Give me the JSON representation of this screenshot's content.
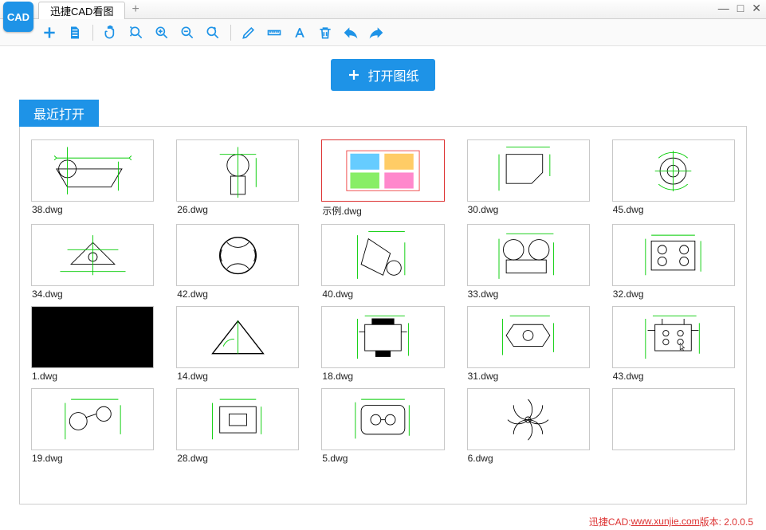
{
  "titlebar": {
    "app_icon_text": "CAD",
    "tab_title": "迅捷CAD看图"
  },
  "toolbar": {
    "icons": [
      {
        "name": "plus-icon"
      },
      {
        "name": "file-icon"
      },
      {
        "name": "pan-icon"
      },
      {
        "name": "zoom-fit-icon"
      },
      {
        "name": "zoom-in-icon"
      },
      {
        "name": "zoom-out-icon"
      },
      {
        "name": "rotate-icon"
      },
      {
        "name": "edit-icon"
      },
      {
        "name": "ruler-icon"
      },
      {
        "name": "text-icon"
      },
      {
        "name": "delete-icon"
      },
      {
        "name": "undo-icon"
      },
      {
        "name": "redo-icon"
      }
    ]
  },
  "content": {
    "open_button_label": "打开图纸",
    "recent_label": "最近打开",
    "files": [
      {
        "name": "38.dwg",
        "kind": "cad-a"
      },
      {
        "name": "26.dwg",
        "kind": "cad-b"
      },
      {
        "name": "示例.dwg",
        "kind": "example",
        "redborder": true
      },
      {
        "name": "30.dwg",
        "kind": "cad-c"
      },
      {
        "name": "45.dwg",
        "kind": "cad-d"
      },
      {
        "name": "34.dwg",
        "kind": "cad-e"
      },
      {
        "name": "42.dwg",
        "kind": "cad-f"
      },
      {
        "name": "40.dwg",
        "kind": "cad-g"
      },
      {
        "name": "33.dwg",
        "kind": "cad-h"
      },
      {
        "name": "32.dwg",
        "kind": "cad-i"
      },
      {
        "name": "1.dwg",
        "kind": "black"
      },
      {
        "name": "14.dwg",
        "kind": "cad-j"
      },
      {
        "name": "18.dwg",
        "kind": "cad-k"
      },
      {
        "name": "31.dwg",
        "kind": "cad-l"
      },
      {
        "name": "43.dwg",
        "kind": "cad-m",
        "cursor": true
      },
      {
        "name": "19.dwg",
        "kind": "cad-n"
      },
      {
        "name": "28.dwg",
        "kind": "cad-o"
      },
      {
        "name": "5.dwg",
        "kind": "cad-p"
      },
      {
        "name": "6.dwg",
        "kind": "cad-q"
      },
      {
        "name": "",
        "kind": "empty"
      }
    ]
  },
  "footer": {
    "prefix": "迅捷CAD: ",
    "url": "www.xunjie.com",
    "suffix": " 版本: 2.0.0.5"
  }
}
